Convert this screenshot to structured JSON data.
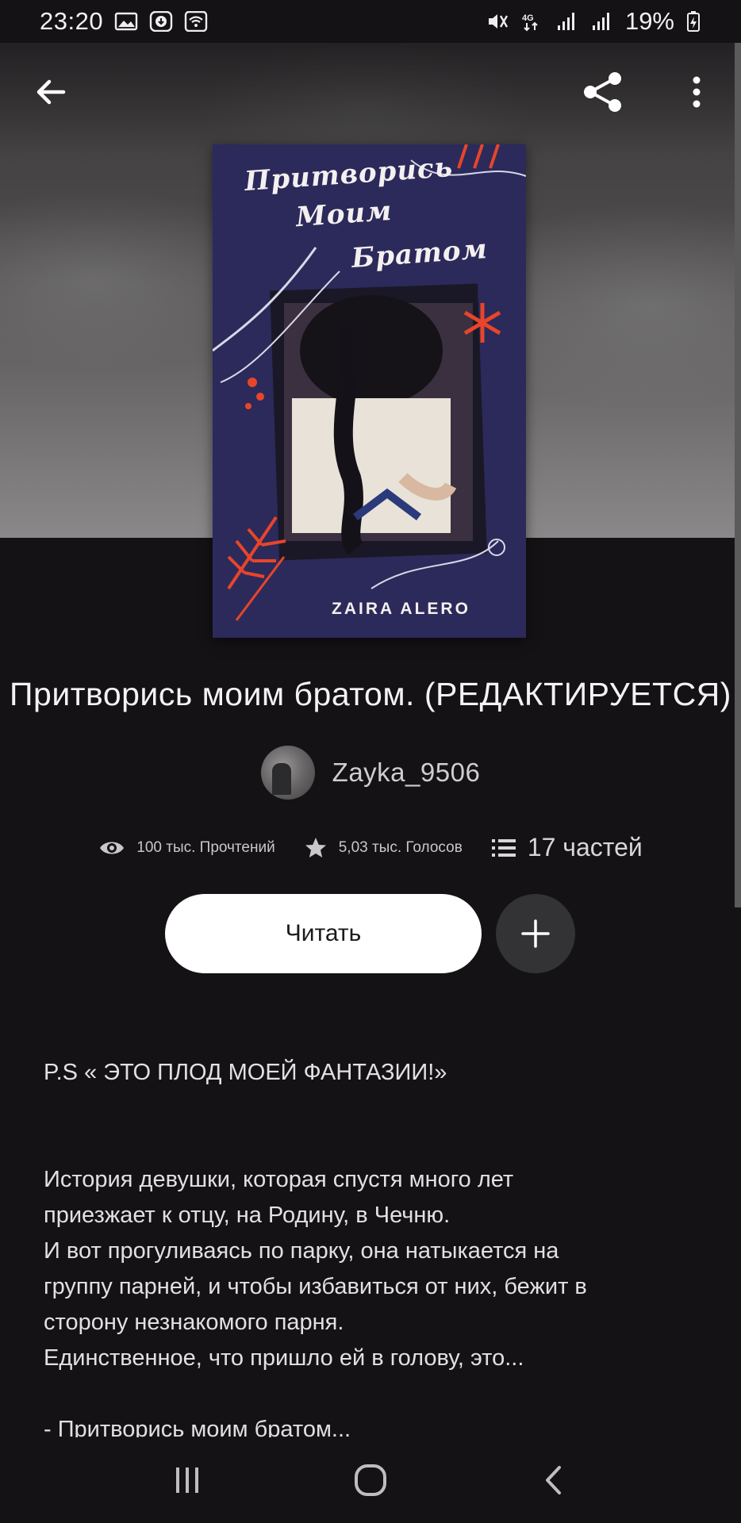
{
  "status_bar": {
    "time": "23:20",
    "battery": "19%",
    "network": "4G",
    "icons": [
      "gallery-icon",
      "download-icon",
      "wifi-icon",
      "mute-icon",
      "signal-icon",
      "battery-icon"
    ]
  },
  "toolbar": {
    "back_icon": "arrow-left-icon",
    "share_icon": "share-icon",
    "more_icon": "more-vertical-icon"
  },
  "cover": {
    "title_lines": [
      "Притворись",
      "Моим",
      "Братом"
    ],
    "author": "ZAIRA ALERO",
    "colors": {
      "background": "#2c2a5a",
      "accent": "#e8452a",
      "line": "#d8d8e8"
    }
  },
  "story": {
    "title": "Притворись моим братом. (РЕДАКТИРУЕТСЯ)",
    "author": "Zayka_9506",
    "stats": {
      "reads": "100 тыс. Прочтений",
      "votes": "5,03 тыс. Голосов",
      "parts": "17 частей"
    },
    "read_button": "Читать"
  },
  "description": {
    "ps": "P.S « ЭТО ПЛОД МОЕЙ ФАНТАЗИИ!»",
    "paragraph": [
      "История девушки, которая спустя много лет",
      "приезжает к отцу, на Родину, в Чечню.",
      "И вот прогуливаясь по парку, она натыкается на",
      "группу парней, и чтобы избавиться от них, бежит в",
      "сторону незнакомого парня.",
      "Единственное, что пришло ей в голову, это..."
    ],
    "quote": "- Притворись моим братом..."
  },
  "nav_bar": {
    "icons": [
      "recent-apps-icon",
      "home-icon",
      "back-icon"
    ]
  }
}
